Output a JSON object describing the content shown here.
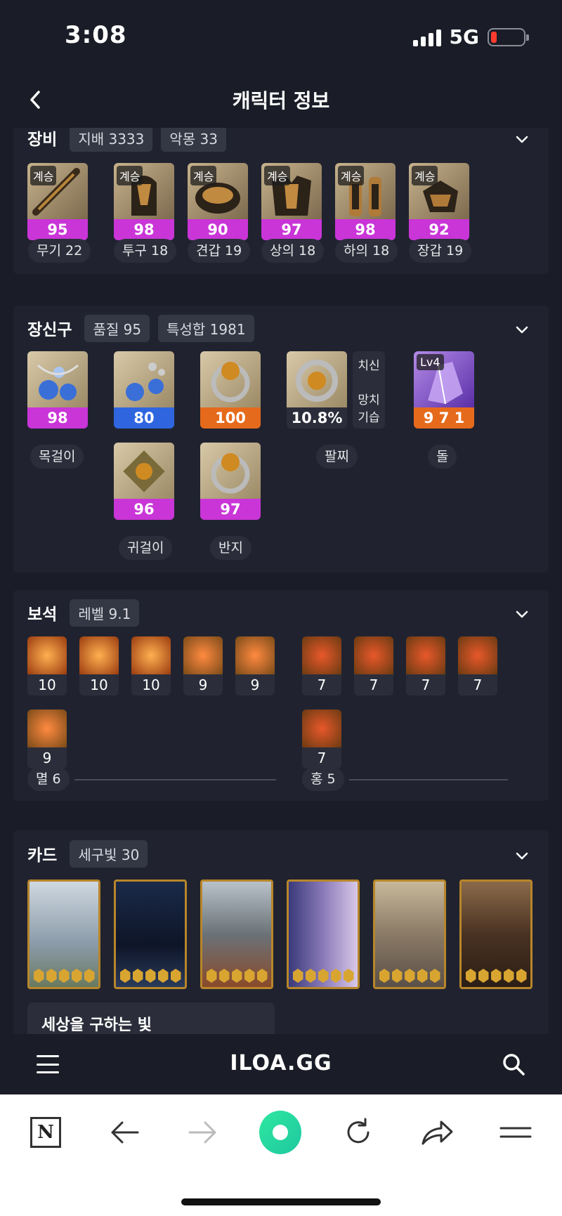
{
  "status": {
    "time": "3:08",
    "network": "5G"
  },
  "header": {
    "title": "캐릭터 정보"
  },
  "equipment": {
    "title": "장비",
    "chips": [
      "지배 3333",
      "악몽 33"
    ],
    "items": [
      {
        "badge": "계승",
        "quality": "95",
        "label": "무기 22"
      },
      {
        "badge": "계승",
        "quality": "98",
        "label": "투구 18"
      },
      {
        "badge": "계승",
        "quality": "90",
        "label": "견갑 19"
      },
      {
        "badge": "계승",
        "quality": "97",
        "label": "상의 18"
      },
      {
        "badge": "계승",
        "quality": "98",
        "label": "하의 18"
      },
      {
        "badge": "계승",
        "quality": "92",
        "label": "장갑 19"
      }
    ]
  },
  "accessories": {
    "title": "장신구",
    "chips": [
      "품질 95",
      "특성합 1981"
    ],
    "necklace": {
      "quality": "98",
      "label": "목걸이"
    },
    "earring1": {
      "quality": "80"
    },
    "earring2": {
      "quality": "96",
      "label": "귀걸이"
    },
    "ring1": {
      "quality": "100"
    },
    "ring2": {
      "quality": "97",
      "label": "반지"
    },
    "bracelet": {
      "value": "10.8%",
      "stat1": "치신",
      "stat2": "망치",
      "stat3": "기습",
      "label": "팔찌"
    },
    "stone": {
      "level": "Lv4",
      "value": "9 7 1",
      "label": "돌"
    }
  },
  "gems": {
    "title": "보석",
    "chip": "레벨 9.1",
    "left": [
      "10",
      "10",
      "10",
      "9",
      "9",
      "9"
    ],
    "right": [
      "7",
      "7",
      "7",
      "7",
      "7"
    ],
    "left_label": "멸 6",
    "right_label": "홍 5"
  },
  "cards": {
    "title": "카드",
    "chip": "세구빛 30",
    "next_label": "세상을 구하는 빛",
    "count": 6,
    "stars_each": 5
  },
  "appbar": {
    "logo": "ILOA.GG"
  },
  "colors": {
    "purple": "#c935d7",
    "blue": "#2f66e0",
    "orange": "#e66a1c",
    "bg": "#1a1d27",
    "panel": "#20232f"
  }
}
